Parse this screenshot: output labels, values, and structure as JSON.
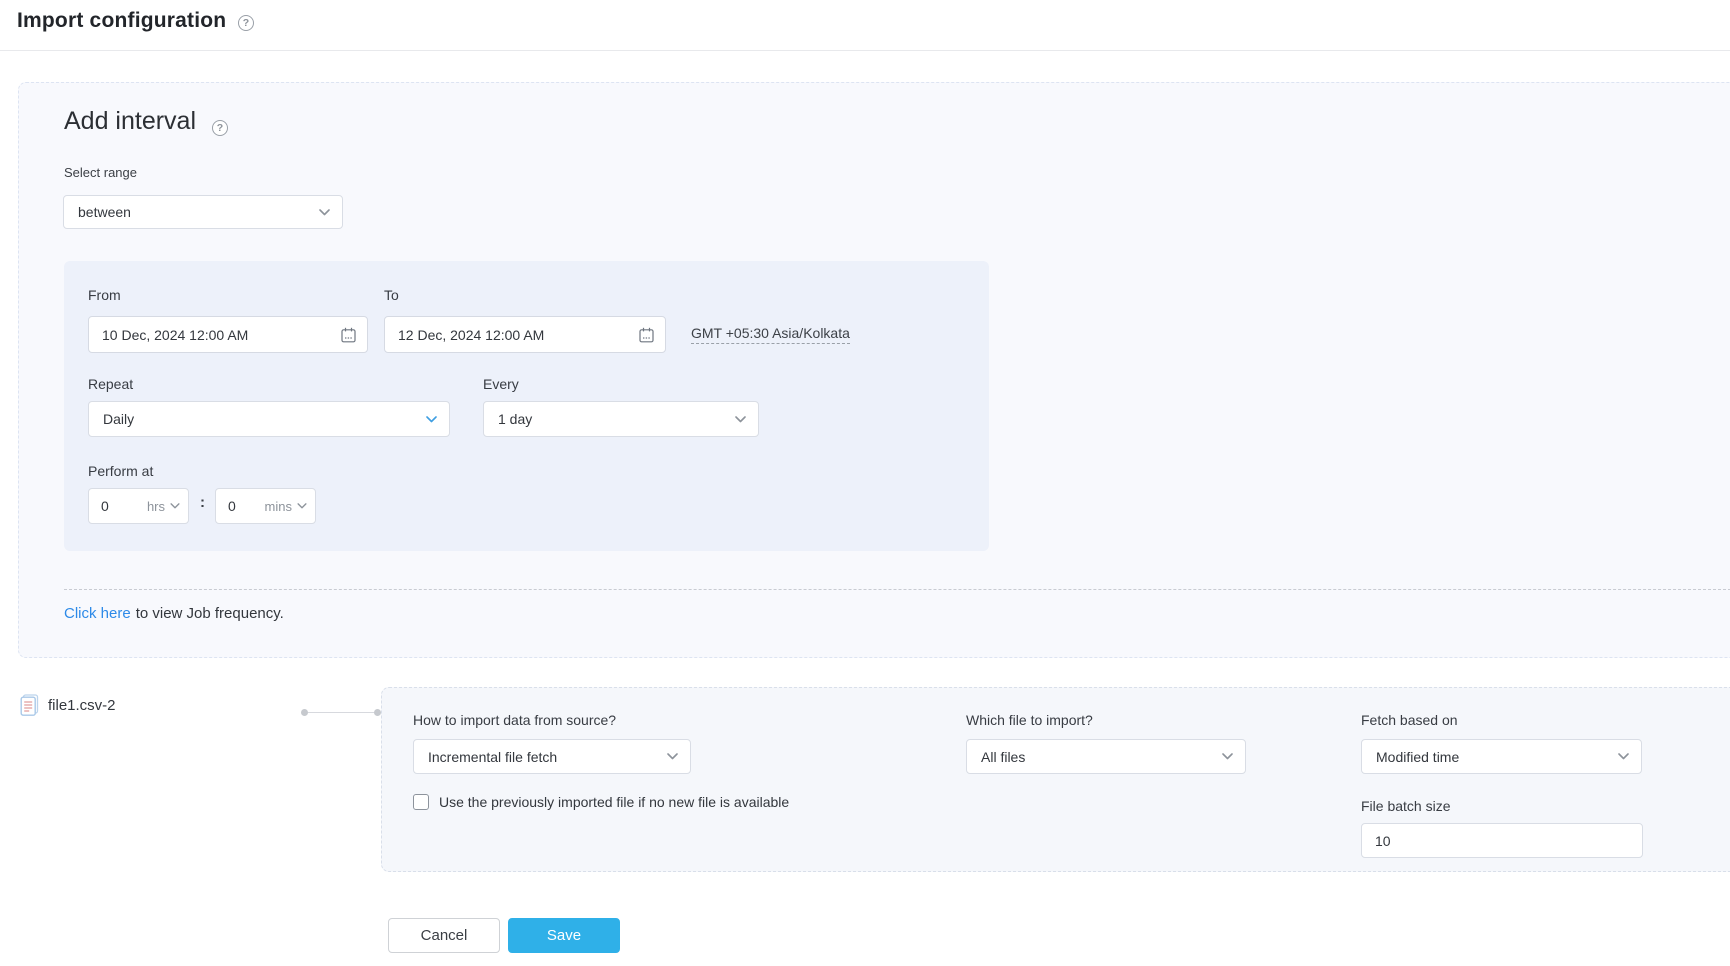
{
  "page": {
    "title": "Import configuration"
  },
  "icons": {
    "help_glyph": "?",
    "calendar": "calendar-icon",
    "chevron": "chevron-down-icon",
    "file": "csv-file-icon"
  },
  "add_interval": {
    "title": "Add interval",
    "select_range_label": "Select range",
    "select_range_value": "between",
    "from_label": "From",
    "from_value": "10 Dec, 2024 12:00 AM",
    "to_label": "To",
    "to_value": "12 Dec, 2024 12:00 AM",
    "timezone": "GMT +05:30 Asia/Kolkata",
    "repeat_label": "Repeat",
    "repeat_value": "Daily",
    "every_label": "Every",
    "every_value": "1 day",
    "perform_at_label": "Perform at",
    "hours_value": "0",
    "hours_unit": "hrs",
    "time_separator": ":",
    "minutes_value": "0",
    "minutes_unit": "mins",
    "job_frequency_link": "Click here",
    "job_frequency_text": "to view Job frequency."
  },
  "file_section": {
    "file_name": "file1.csv-2",
    "import_mode_label": "How to import data from source?",
    "import_mode_value": "Incremental file fetch",
    "checkbox_label": "Use the previously imported file if no new file is available",
    "checkbox_checked": false,
    "which_file_label": "Which file to import?",
    "which_file_value": "All files",
    "fetch_based_label": "Fetch based on",
    "fetch_based_value": "Modified time",
    "batch_size_label": "File batch size",
    "batch_size_value": "10"
  },
  "actions": {
    "cancel_label": "Cancel",
    "save_label": "Save"
  },
  "colors": {
    "save_button": "#2fb0e8",
    "link_blue": "#2d8ae8",
    "outer_panel_bg": "#f8f9fd",
    "inner_panel_bg": "#edf1fa",
    "config_panel_bg": "#f5f7fb",
    "repeat_chevron_blue": "#3e9ee2"
  }
}
